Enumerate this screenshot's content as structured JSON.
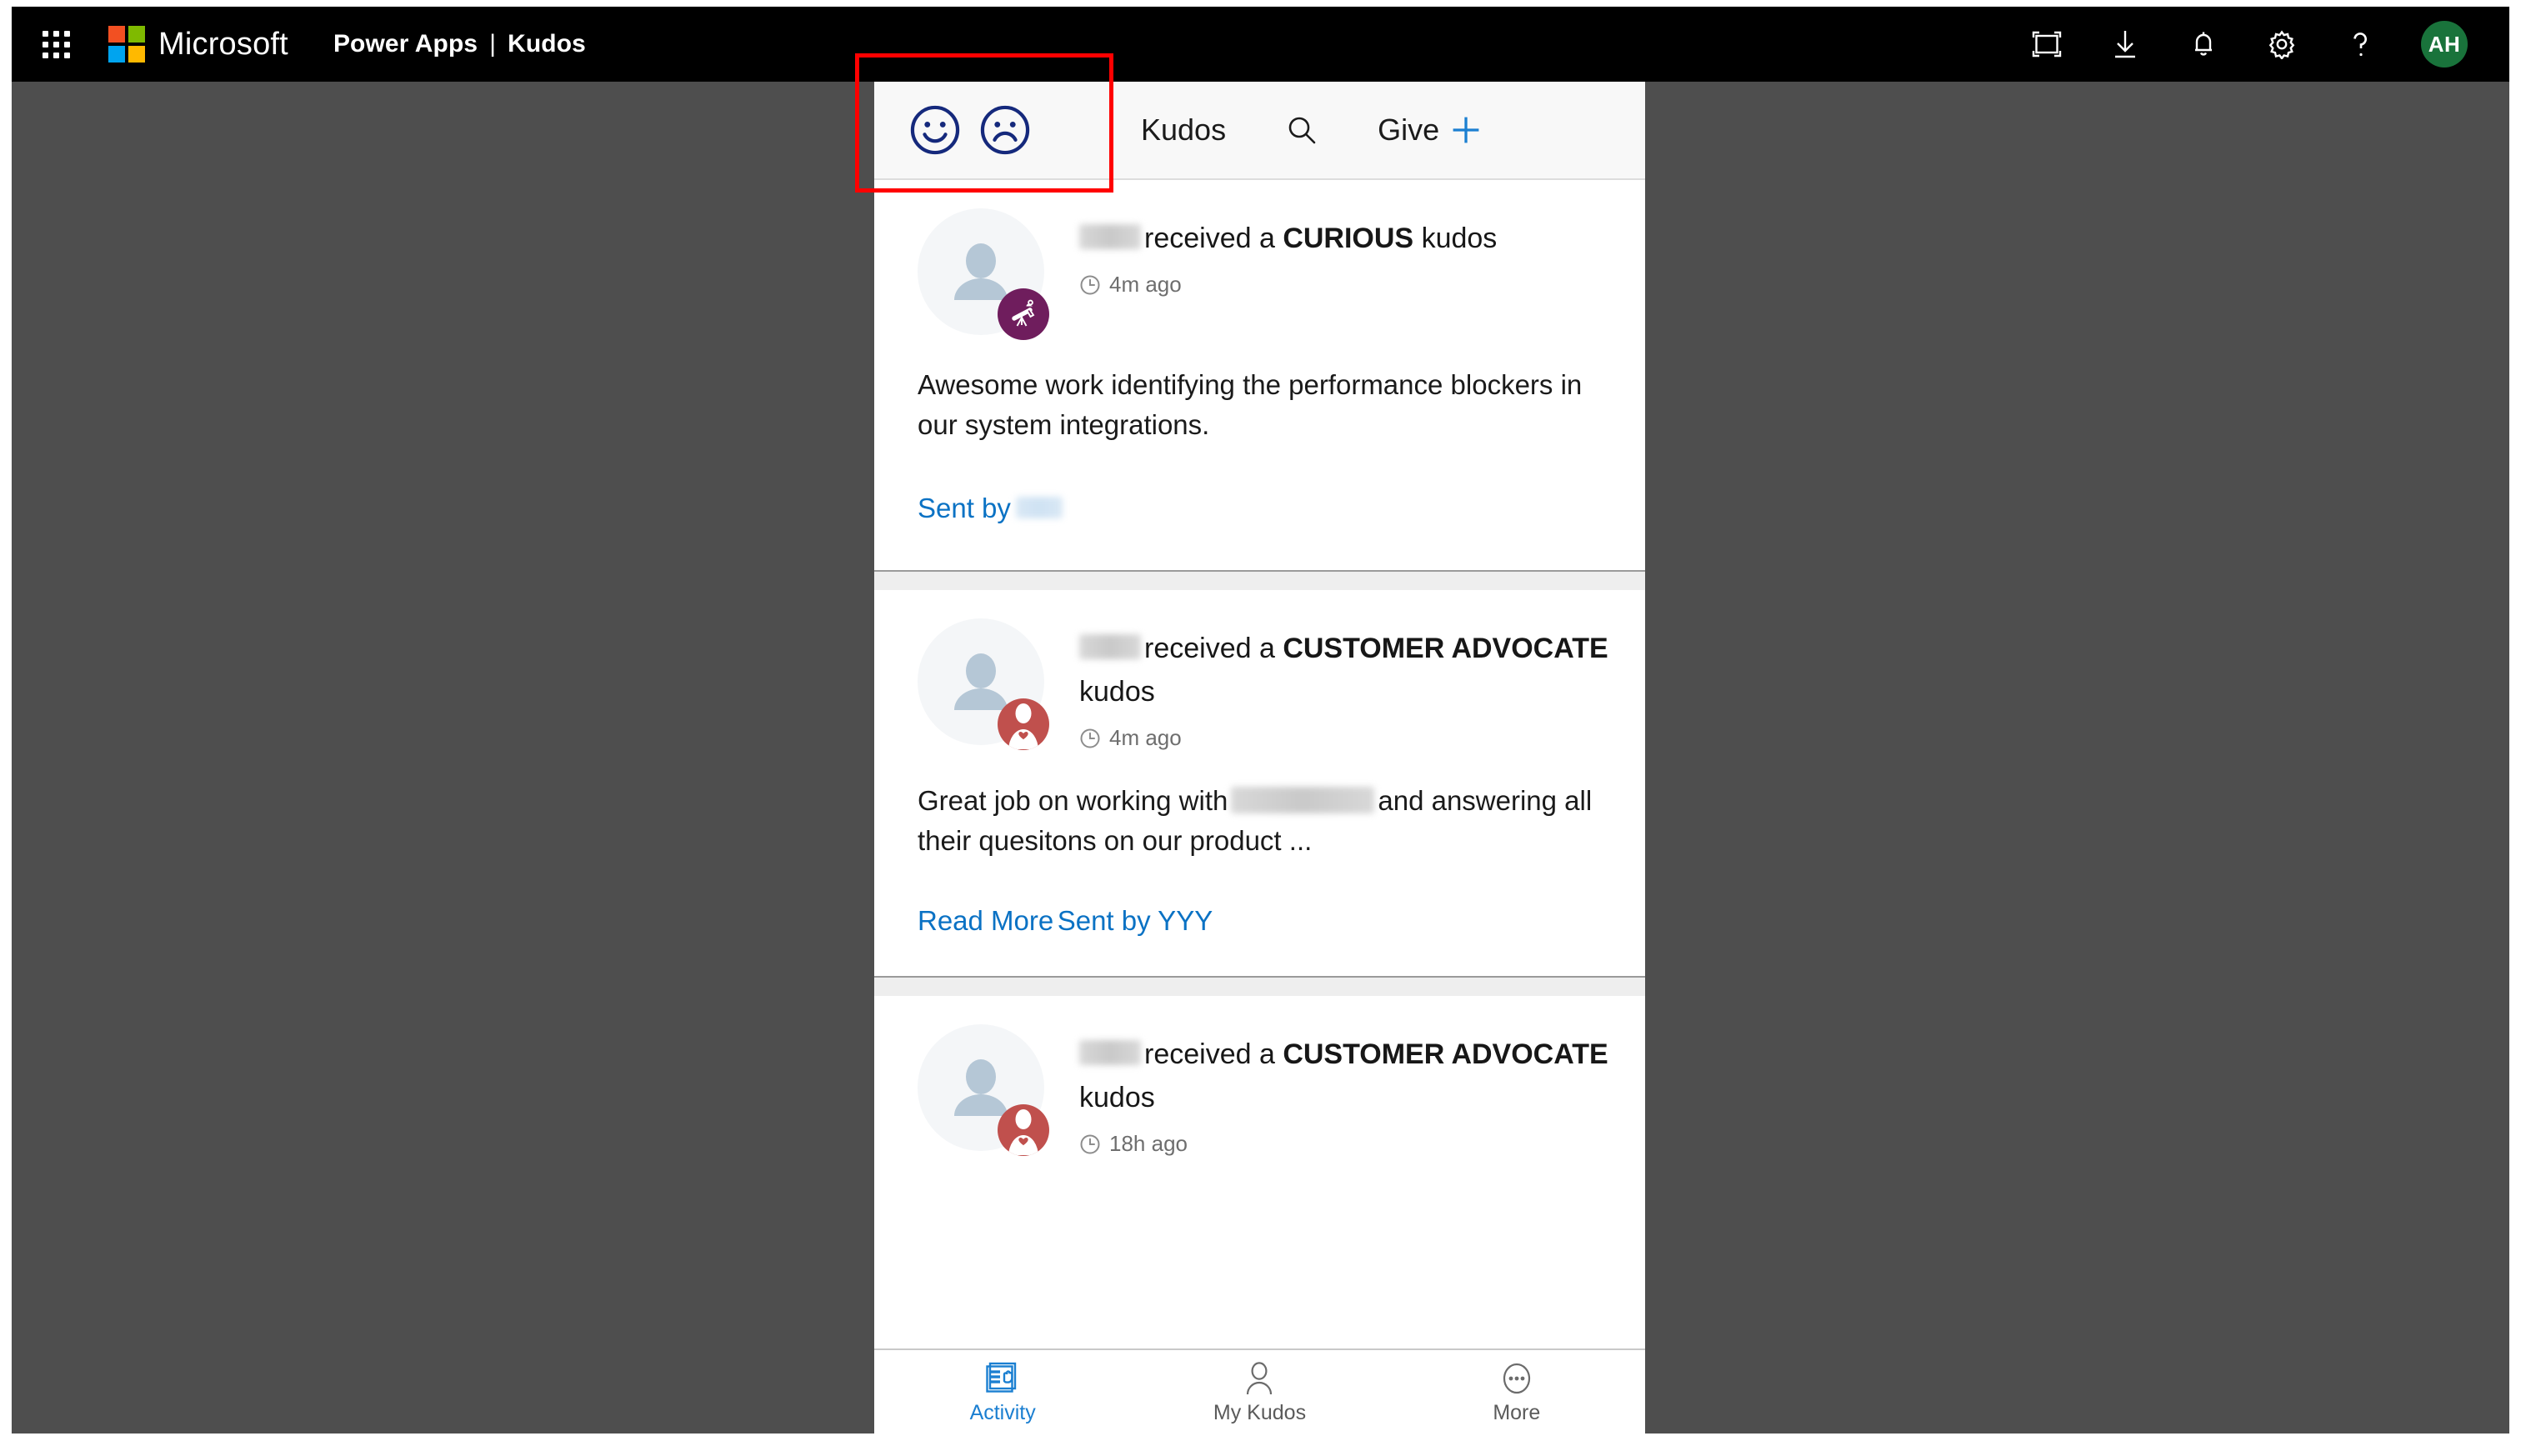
{
  "suite_bar": {
    "waffle_icon": "app-launcher-icon",
    "brand": "Microsoft",
    "app_name": "Power Apps",
    "divider": "|",
    "page_name": "Kudos",
    "icons": [
      {
        "name": "fullscreen-icon",
        "label": "Fullscreen"
      },
      {
        "name": "download-icon",
        "label": "Download"
      },
      {
        "name": "notifications-bell-icon",
        "label": "Notifications"
      },
      {
        "name": "settings-gear-icon",
        "label": "Settings"
      },
      {
        "name": "help-question-icon",
        "label": "Help"
      }
    ],
    "avatar_initials": "AH",
    "avatar_color": "#19733b"
  },
  "app_header": {
    "happy_face_icon": "happy-face-icon",
    "sad_face_icon": "sad-face-icon",
    "title": "Kudos",
    "search_icon": "search-icon",
    "give_label": "Give",
    "give_plus_icon": "plus-icon",
    "accent_color": "#1b7fd1",
    "face_color": "#15297c"
  },
  "feed": {
    "cards": [
      {
        "recipient_redacted": true,
        "headline_prefix": "received a",
        "kudos_type": "CURIOUS",
        "headline_suffix": "kudos",
        "time": "4m ago",
        "badge": {
          "name": "telescope-badge-icon",
          "color": "#6f1d5d"
        },
        "message": "Awesome work identifying the performance blockers in our system integrations.",
        "read_more": null,
        "sent_by_label": "Sent by",
        "sent_by_name_redacted": true,
        "sent_by_name": ""
      },
      {
        "recipient_redacted": true,
        "headline_prefix": "received a",
        "kudos_type": "CUSTOMER ADVOCATE",
        "headline_suffix": "kudos",
        "time": "4m ago",
        "badge": {
          "name": "customer-advocate-badge-icon",
          "color": "#c0504d"
        },
        "message_part1": "Great job on working with",
        "message_part2": "and answering all their quesitons on our product ...",
        "read_more": "Read More",
        "sent_by_label": "Sent by YYY",
        "sent_by_name_redacted": false,
        "sent_by_name": ""
      },
      {
        "recipient_redacted": true,
        "headline_prefix": "received a",
        "kudos_type": "CUSTOMER ADVOCATE",
        "headline_suffix": "kudos",
        "time": "18h ago",
        "badge": {
          "name": "customer-advocate-badge-icon",
          "color": "#c0504d"
        },
        "message": "",
        "read_more": null,
        "sent_by_label": "",
        "sent_by_name_redacted": false,
        "sent_by_name": ""
      }
    ]
  },
  "bottom_nav": {
    "items": [
      {
        "label": "Activity",
        "icon": "activity-feed-icon",
        "active": true
      },
      {
        "label": "My Kudos",
        "icon": "person-outline-icon",
        "active": false
      },
      {
        "label": "More",
        "icon": "more-ellipsis-icon",
        "active": false
      }
    ]
  },
  "annotation": {
    "name": "red-highlight-box",
    "color": "#ff0000"
  }
}
